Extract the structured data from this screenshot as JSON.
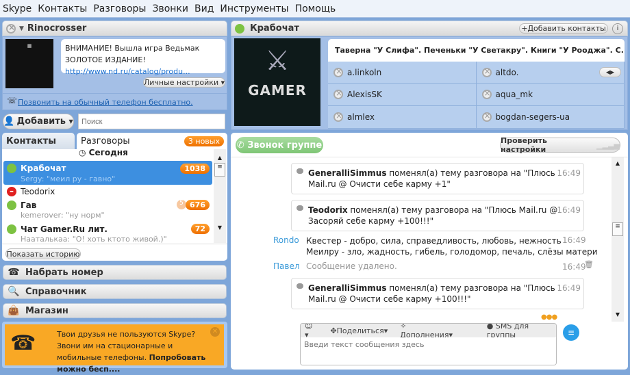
{
  "menu": [
    "Skype",
    "Контакты",
    "Разговоры",
    "Звонки",
    "Вид",
    "Инструменты",
    "Помощь"
  ],
  "profile": {
    "name": "Rinocrosser",
    "mood": "ВНИМАНИЕ! Вышла игра Ведьмак ЗОЛОТОЕ ИЗДАНИЕ! ",
    "mood_link": "http://www.nd.ru/catalog/produ...",
    "settings_label": "Личные настройки",
    "call_free": "Позвонить на обычный телефон бесплатно."
  },
  "add_label": "Добавить",
  "search_placeholder": "Поиск",
  "tabs": {
    "contacts": "Контакты",
    "conversations": "Разговоры",
    "new_badge": "3 новых"
  },
  "list_group": "Сегодня",
  "conversations": [
    {
      "name": "Крабочат",
      "preview": "Sergy: \"меил ру - гавно\"",
      "count": "1038",
      "status": "online"
    },
    {
      "name": "Teodorix",
      "preview": "",
      "count": "",
      "status": "dnd"
    },
    {
      "name": "Гав",
      "preview": "kemerover: \"ну норм\"",
      "count": "676",
      "status": "online",
      "extra": "5"
    },
    {
      "name": "Чат Gamer.Ru лит.",
      "preview": "Нааталькаа: \"О! хоть ктото живой.)\"",
      "count": "72",
      "status": "online"
    }
  ],
  "show_history": "Показать историю",
  "nav": [
    {
      "label": "Набрать номер",
      "icon": "☎"
    },
    {
      "label": "Справочник",
      "icon": "🔍"
    },
    {
      "label": "Магазин",
      "icon": "👜"
    }
  ],
  "promo": {
    "text": "Твои друзья не пользуются Skype? Звони им на стационарные и мобильные телефоны. ",
    "bold": "Попробовать можно бесп...."
  },
  "chat": {
    "title": "Крабочат",
    "add_contacts": "Добавить контакты",
    "topic": "Таверна \"У Слифа\". Печеньки \"У Светакру\". Книги \"У Рооджа\". С...",
    "avatar_text": "GAMER",
    "participants": [
      "a.linkoln",
      "altdo.",
      "AlexisSK",
      "aqua_mk",
      "almlex",
      "bogdan-segers-ua"
    ],
    "call_group": "Звонок группе",
    "check_settings": "Проверить настройки",
    "messages": [
      {
        "type": "event",
        "who": "GeneralliSimmus",
        "text": " поменял(а) тему разговора на \"Плюсь Mail.ru @ Очисти себе карму +1\"",
        "time": "16:49"
      },
      {
        "type": "event",
        "who": "Teodorix",
        "text": " поменял(а) тему разговора на \"Плюсь Mail.ru @ Засоряй себе карму +100!!!\"",
        "time": "16:49"
      },
      {
        "type": "msg",
        "who": "Rondo",
        "line1": "Квестер - добро, сила, справедливость, любовь, нежность",
        "line2": "Меилру  - зло, жадность, гибель, голодомор, печаль, слёзы матери",
        "time": "16:49"
      },
      {
        "type": "deleted",
        "who": "Павел",
        "text": "Сообщение удалено.",
        "time": "16:49"
      },
      {
        "type": "event",
        "who": "GeneralliSimmus",
        "text": " поменял(а) тему разговора на \"Плюсь Mail.ru @ Очисти себе карму +100!!!\"",
        "time": "16:49"
      }
    ],
    "toolbar": {
      "share": "Поделиться",
      "addons": "Дополнения",
      "sms": "SMS для группы"
    },
    "input_placeholder": "Введи текст сообщения здесь"
  },
  "colors": {
    "accent": "#ee7000",
    "selected": "#3d8fe0",
    "window": "#7ea6d9"
  }
}
